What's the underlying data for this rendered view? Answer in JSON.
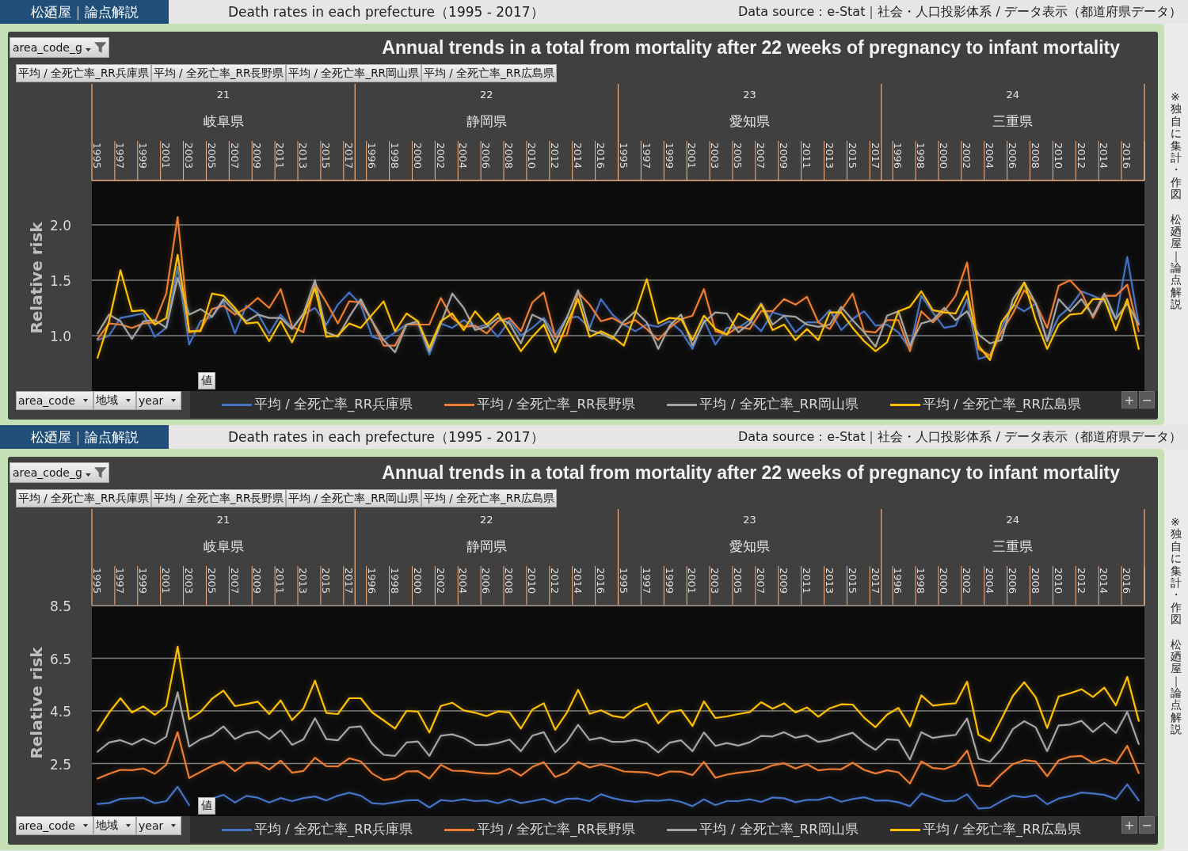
{
  "panels": [
    {
      "brand": "松廼屋｜論点解説",
      "page_title": "Death rates in each prefecture（1995 - 2017）",
      "data_source": "Data source：e-Stat｜社会・人口投影体系 / データ表示（都道府県データ）",
      "side_note": [
        "※独自に集計・作図",
        "松廼屋｜論点解説"
      ],
      "filter_field": "area_code_g",
      "chart_title": "Annual trends in a total from mortality after 22 weeks of pregnancy to infant mortality",
      "value_fields": [
        "平均 / 全死亡率_RR兵庫県",
        "平均 / 全死亡率_RR長野県",
        "平均 / 全死亡率_RR岡山県",
        "平均 / 全死亡率_RR広島県"
      ],
      "value_button": "値",
      "axis_fields": [
        "area_code",
        "地域",
        "year"
      ],
      "zoom_buttons": [
        "+",
        "−"
      ],
      "x_groups": [
        {
          "code": "21",
          "name": "岐阜県"
        },
        {
          "code": "22",
          "name": "静岡県"
        },
        {
          "code": "23",
          "name": "愛知県"
        },
        {
          "code": "24",
          "name": "三重県"
        }
      ],
      "chart_data": {
        "type": "line",
        "ylabel": "Relative risk",
        "grid": true,
        "ylim": [
          0.5,
          2.4
        ],
        "yticks": [
          {
            "value": 1.0,
            "label": "1.0"
          },
          {
            "value": 1.5,
            "label": "1.5"
          },
          {
            "value": 2.0,
            "label": "2.0"
          }
        ],
        "categories": [
          "1995",
          null,
          "1997",
          null,
          "1999",
          null,
          "2001",
          null,
          "2003",
          null,
          "2005",
          null,
          "2007",
          null,
          "2009",
          null,
          "2011",
          null,
          "2013",
          null,
          "2015",
          null,
          "2017",
          null,
          "1996",
          null,
          "1998",
          null,
          "2000",
          null,
          "2002",
          null,
          "2004",
          null,
          "2006",
          null,
          "2008",
          null,
          "2010",
          null,
          "2012",
          null,
          "2014",
          null,
          "2016",
          null,
          "1995",
          null,
          "1997",
          null,
          "1999",
          null,
          "2001",
          null,
          "2003",
          null,
          "2005",
          null,
          "2007",
          null,
          "2009",
          null,
          "2011",
          null,
          "2013",
          null,
          "2015",
          null,
          "2017",
          null,
          "1996",
          null,
          "1998",
          null,
          "2000",
          null,
          "2002",
          null,
          "2004",
          null,
          "2006",
          null,
          "2008",
          null,
          "2010",
          null,
          "2012",
          null,
          "2014",
          null,
          "2016",
          null
        ],
        "series": [
          {
            "name": "平均 / 全死亡率_RR兵庫県",
            "color": "#4472c4",
            "values": [
              0.96,
              1.0,
              1.16,
              1.18,
              1.2,
              0.99,
              1.07,
              1.62,
              0.92,
              1.13,
              1.17,
              1.31,
              1.02,
              1.27,
              1.2,
              1.02,
              1.19,
              1.07,
              1.19,
              1.25,
              1.1,
              1.28,
              1.39,
              1.28,
              0.99,
              0.96,
              1.03,
              1.1,
              1.11,
              0.83,
              1.11,
              1.07,
              1.14,
              1.07,
              1.1,
              0.99,
              1.14,
              1.0,
              1.07,
              1.16,
              1.0,
              1.16,
              1.17,
              1.07,
              1.33,
              1.19,
              1.1,
              1.04,
              1.1,
              1.08,
              1.13,
              1.04,
              0.88,
              1.14,
              0.92,
              1.07,
              1.07,
              1.14,
              1.04,
              1.21,
              1.18,
              1.03,
              1.12,
              1.12,
              1.23,
              1.05,
              1.15,
              1.22,
              1.09,
              1.1,
              1.03,
              0.88,
              1.36,
              1.21,
              1.07,
              1.09,
              1.33,
              0.79,
              0.82,
              1.07,
              1.28,
              1.22,
              1.29,
              0.95,
              1.17,
              1.26,
              1.4,
              1.36,
              1.31,
              1.15,
              1.71,
              1.1
            ]
          },
          {
            "name": "平均 / 全死亡率_RR長野県",
            "color": "#ed7d31",
            "values": [
              0.97,
              1.11,
              1.1,
              1.07,
              1.11,
              1.12,
              1.38,
              2.07,
              1.03,
              1.05,
              1.24,
              1.27,
              1.19,
              1.25,
              1.34,
              1.25,
              1.42,
              1.08,
              1.03,
              1.47,
              1.3,
              1.11,
              1.31,
              1.3,
              1.13,
              0.91,
              0.91,
              1.1,
              1.1,
              1.1,
              1.34,
              1.16,
              1.08,
              1.09,
              1.02,
              1.13,
              1.16,
              1.04,
              1.3,
              1.39,
              0.99,
              1.0,
              1.39,
              1.28,
              1.13,
              1.16,
              1.1,
              1.14,
              1.06,
              0.96,
              1.07,
              1.15,
              1.18,
              1.42,
              1.04,
              1.01,
              1.08,
              1.06,
              1.22,
              1.22,
              1.33,
              1.28,
              1.35,
              1.12,
              1.06,
              1.23,
              1.38,
              1.04,
              1.03,
              1.14,
              1.14,
              0.86,
              1.22,
              1.12,
              1.22,
              1.36,
              1.66,
              0.88,
              0.82,
              1.03,
              1.2,
              1.41,
              1.29,
              1.07,
              1.45,
              1.5,
              1.39,
              1.16,
              1.36,
              1.36,
              1.46,
              1.04
            ]
          },
          {
            "name": "平均 / 全死亡率_RR岡山県",
            "color": "#a5a5a5",
            "values": [
              1.02,
              1.19,
              1.13,
              0.97,
              1.13,
              1.14,
              1.07,
              1.52,
              1.19,
              1.24,
              1.17,
              1.33,
              1.22,
              1.13,
              1.19,
              1.16,
              1.16,
              1.06,
              1.2,
              1.5,
              1.03,
              0.99,
              1.17,
              1.33,
              1.13,
              0.96,
              0.85,
              1.1,
              1.13,
              0.86,
              1.11,
              1.38,
              1.25,
              1.05,
              1.08,
              1.16,
              1.11,
              0.93,
              1.19,
              1.14,
              0.94,
              1.16,
              1.41,
              1.05,
              1.02,
              0.97,
              1.13,
              1.22,
              1.12,
              0.88,
              1.09,
              1.19,
              0.91,
              1.12,
              1.21,
              1.2,
              1.03,
              1.11,
              1.29,
              1.1,
              1.18,
              1.17,
              1.1,
              1.08,
              1.1,
              1.26,
              1.14,
              1.03,
              0.9,
              1.18,
              1.22,
              0.91,
              1.11,
              1.14,
              1.25,
              1.14,
              1.22,
              1.01,
              0.93,
              0.96,
              1.33,
              1.48,
              1.29,
              0.95,
              1.33,
              1.22,
              1.33,
              1.18,
              1.38,
              1.15,
              1.29,
              1.1
            ]
          },
          {
            "name": "平均 / 全死亡率_RR広島県",
            "color": "#ffc000",
            "values": [
              0.8,
              1.13,
              1.59,
              1.22,
              1.23,
              1.1,
              1.16,
              1.73,
              1.04,
              1.04,
              1.38,
              1.36,
              1.25,
              1.11,
              1.12,
              0.95,
              1.13,
              0.94,
              1.17,
              1.43,
              0.99,
              1.0,
              1.11,
              1.07,
              1.19,
              1.31,
              1.04,
              1.2,
              1.13,
              0.89,
              1.13,
              1.2,
              1.05,
              1.22,
              1.1,
              1.2,
              1.03,
              0.86,
              0.99,
              1.1,
              0.85,
              1.1,
              1.33,
              0.99,
              1.04,
              0.99,
              0.91,
              1.2,
              1.51,
              1.11,
              1.16,
              1.15,
              0.96,
              1.18,
              1.06,
              1.01,
              1.2,
              1.14,
              1.28,
              1.05,
              1.1,
              0.96,
              1.06,
              0.96,
              1.21,
              1.21,
              1.07,
              0.95,
              0.86,
              0.94,
              1.22,
              1.26,
              1.4,
              1.23,
              1.21,
              1.2,
              1.4,
              0.91,
              0.78,
              1.12,
              1.26,
              1.48,
              1.14,
              0.88,
              1.1,
              1.19,
              1.2,
              1.33,
              1.33,
              1.05,
              1.33,
              0.88
            ]
          }
        ]
      }
    },
    {
      "brand": "松廼屋｜論点解説",
      "page_title": "Death rates in each prefecture（1995 - 2017）",
      "data_source": "Data source：e-Stat｜社会・人口投影体系 / データ表示（都道府県データ）",
      "side_note": [
        "※独自に集計・作図",
        "松廼屋｜論点解説"
      ],
      "filter_field": "area_code_g",
      "chart_title": "Annual trends in a total from mortality after 22 weeks of pregnancy to infant mortality",
      "value_fields": [
        "平均 / 全死亡率_RR兵庫県",
        "平均 / 全死亡率_RR長野県",
        "平均 / 全死亡率_RR岡山県",
        "平均 / 全死亡率_RR広島県"
      ],
      "value_button": "値",
      "axis_fields": [
        "area_code",
        "地域",
        "year"
      ],
      "zoom_buttons": [
        "+",
        "−"
      ],
      "x_groups": [
        {
          "code": "21",
          "name": "岐阜県"
        },
        {
          "code": "22",
          "name": "静岡県"
        },
        {
          "code": "23",
          "name": "愛知県"
        },
        {
          "code": "24",
          "name": "三重県"
        }
      ],
      "chart_data": {
        "type": "line",
        "ylabel": "Relative risk",
        "grid": true,
        "ylim": [
          0.5,
          8.5
        ],
        "yticks": [
          {
            "value": 2.5,
            "label": "2.5"
          },
          {
            "value": 4.5,
            "label": "4.5"
          },
          {
            "value": 6.5,
            "label": "6.5"
          },
          {
            "value": 8.5,
            "label": "8.5"
          }
        ],
        "categories": [
          "1995",
          null,
          "1997",
          null,
          "1999",
          null,
          "2001",
          null,
          "2003",
          null,
          "2005",
          null,
          "2007",
          null,
          "2009",
          null,
          "2011",
          null,
          "2013",
          null,
          "2015",
          null,
          "2017",
          null,
          "1996",
          null,
          "1998",
          null,
          "2000",
          null,
          "2002",
          null,
          "2004",
          null,
          "2006",
          null,
          "2008",
          null,
          "2010",
          null,
          "2012",
          null,
          "2014",
          null,
          "2016",
          null,
          "1995",
          null,
          "1997",
          null,
          "1999",
          null,
          "2001",
          null,
          "2003",
          null,
          "2005",
          null,
          "2007",
          null,
          "2009",
          null,
          "2011",
          null,
          "2013",
          null,
          "2015",
          null,
          "2017",
          null,
          "1996",
          null,
          "1998",
          null,
          "2000",
          null,
          "2002",
          null,
          "2004",
          null,
          "2006",
          null,
          "2008",
          null,
          "2010",
          null,
          "2012",
          null,
          "2014",
          null,
          "2016",
          null
        ],
        "series": [
          {
            "name": "平均 / 全死亡率_RR兵庫県",
            "color": "#4472c4",
            "values": [
              0.96,
              1.0,
              1.16,
              1.18,
              1.2,
              0.99,
              1.07,
              1.62,
              0.92,
              null,
              1.17,
              1.31,
              1.02,
              1.27,
              1.2,
              1.02,
              1.19,
              1.07,
              1.19,
              1.25,
              1.1,
              1.28,
              1.39,
              1.28,
              0.99,
              0.96,
              1.03,
              1.1,
              1.11,
              0.83,
              1.11,
              1.07,
              1.14,
              1.07,
              1.1,
              0.99,
              1.14,
              1.0,
              1.07,
              1.16,
              1.0,
              1.16,
              1.17,
              1.07,
              1.33,
              1.19,
              1.1,
              1.04,
              1.1,
              1.08,
              1.13,
              1.04,
              0.88,
              1.14,
              0.92,
              1.07,
              1.07,
              1.14,
              1.04,
              1.21,
              1.18,
              1.03,
              1.12,
              1.12,
              1.23,
              1.05,
              1.15,
              1.22,
              1.09,
              1.1,
              1.03,
              0.88,
              1.36,
              1.21,
              1.07,
              1.09,
              1.33,
              0.79,
              0.82,
              1.07,
              1.28,
              1.22,
              1.29,
              0.95,
              1.17,
              1.26,
              1.4,
              1.36,
              1.31,
              1.15,
              1.71,
              1.1
            ]
          },
          {
            "name": "平均 / 全死亡率_RR長野県",
            "color": "#ed7d31",
            "values": [
              1.93,
              2.11,
              2.26,
              2.25,
              2.31,
              2.11,
              2.45,
              3.69,
              1.95,
              2.18,
              2.41,
              2.58,
              2.21,
              2.52,
              2.54,
              2.27,
              2.61,
              2.15,
              2.22,
              2.72,
              2.4,
              2.39,
              2.7,
              2.58,
              2.12,
              1.87,
              1.94,
              2.2,
              2.21,
              1.93,
              2.45,
              2.23,
              2.22,
              2.16,
              2.12,
              2.12,
              2.3,
              2.04,
              2.37,
              2.55,
              1.99,
              2.16,
              2.56,
              2.35,
              2.46,
              2.35,
              2.2,
              2.18,
              2.16,
              2.04,
              2.2,
              2.19,
              2.06,
              2.56,
              1.96,
              2.08,
              2.15,
              2.2,
              2.26,
              2.43,
              2.51,
              2.31,
              2.47,
              2.24,
              2.29,
              2.28,
              2.53,
              2.26,
              2.12,
              2.24,
              2.17,
              1.74,
              2.58,
              2.33,
              2.29,
              2.45,
              2.99,
              1.67,
              1.64,
              2.1,
              2.48,
              2.63,
              2.58,
              2.02,
              2.62,
              2.76,
              2.79,
              2.52,
              2.67,
              2.51,
              3.17,
              2.14
            ]
          },
          {
            "name": "平均 / 全死亡率_RR岡山県",
            "color": "#a5a5a5",
            "values": [
              2.95,
              3.3,
              3.39,
              3.22,
              3.44,
              3.25,
              3.52,
              5.21,
              3.14,
              3.42,
              3.58,
              3.91,
              3.43,
              3.65,
              3.73,
              3.43,
              3.77,
              3.21,
              3.42,
              4.22,
              3.43,
              3.38,
              3.87,
              3.91,
              3.25,
              2.83,
              2.79,
              3.3,
              3.34,
              2.79,
              3.56,
              3.61,
              3.47,
              3.21,
              3.2,
              3.28,
              3.41,
              2.97,
              3.56,
              3.69,
              2.93,
              3.32,
              3.97,
              3.4,
              3.48,
              3.32,
              3.33,
              3.4,
              3.28,
              2.92,
              3.29,
              3.38,
              2.97,
              3.68,
              3.17,
              3.28,
              3.18,
              3.31,
              3.55,
              3.53,
              3.69,
              3.48,
              3.57,
              3.32,
              3.39,
              3.54,
              3.67,
              3.29,
              3.02,
              3.42,
              3.39,
              2.65,
              3.69,
              3.47,
              3.54,
              3.59,
              4.21,
              2.68,
              2.57,
              3.06,
              3.81,
              4.11,
              3.87,
              2.97,
              3.95,
              3.98,
              4.12,
              3.7,
              4.05,
              3.66,
              4.46,
              3.24
            ]
          },
          {
            "name": "平均 / 全死亡率_RR広島県",
            "color": "#ffc000",
            "values": [
              3.75,
              4.43,
              4.98,
              4.44,
              4.67,
              4.35,
              4.68,
              6.94,
              4.18,
              4.46,
              4.96,
              5.27,
              4.68,
              4.76,
              4.85,
              4.38,
              4.9,
              4.15,
              4.59,
              5.65,
              4.42,
              4.38,
              4.98,
              4.98,
              4.44,
              4.14,
              3.83,
              4.5,
              4.47,
              3.68,
              4.69,
              4.81,
              4.52,
              4.43,
              4.3,
              4.48,
              4.44,
              3.83,
              4.55,
              4.79,
              3.78,
              4.42,
              5.3,
              4.39,
              4.52,
              4.31,
              4.24,
              4.6,
              4.79,
              4.03,
              4.45,
              4.53,
              3.93,
              4.86,
              4.23,
              4.29,
              4.38,
              4.45,
              4.83,
              4.58,
              4.79,
              4.44,
              4.63,
              4.28,
              4.6,
              4.75,
              4.74,
              4.24,
              3.88,
              4.36,
              4.61,
              3.91,
              5.09,
              4.7,
              4.75,
              4.79,
              5.61,
              3.59,
              3.35,
              4.18,
              5.07,
              5.59,
              5.01,
              3.85,
              5.05,
              5.17,
              5.32,
              5.03,
              5.38,
              4.71,
              5.79,
              4.12
            ]
          }
        ]
      }
    }
  ]
}
